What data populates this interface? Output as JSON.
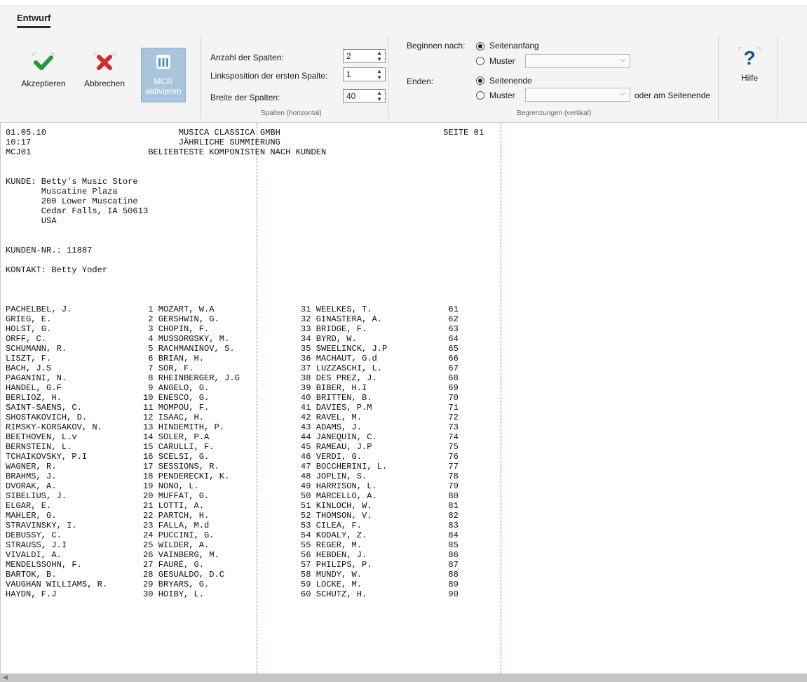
{
  "ribbon": {
    "tab": "Entwurf",
    "buttons": {
      "accept": "Akzeptieren",
      "cancel": "Abbrechen",
      "mcr_line1": "MCR",
      "mcr_line2": "aktivieren",
      "help": "Hilfe"
    },
    "columns_group": {
      "count_label": "Anzahl der Spalten:",
      "count_value": "2",
      "left_label": "Linksposition der ersten Spalte:",
      "left_value": "1",
      "width_label": "Breite der Spalten:",
      "width_value": "40",
      "caption": "Spalten (horizontal)"
    },
    "limits_group": {
      "begin_label": "Beginnen nach:",
      "begin_opt1": "Seitenanfang",
      "begin_opt2": "Muster",
      "end_label": "Enden:",
      "end_opt1": "Seitenende",
      "end_opt2": "Muster",
      "end_suffix": "oder am Seitenende",
      "caption": "Begrenzungen (vertikal)"
    }
  },
  "report": {
    "lines": [
      "01.05.10                          MUSICA CLASSICA GMBH                                SEITE 01",
      "10:17                             JÄHRLICHE SUMMIERUNG",
      "MCJ01                       BELIEBTESTE KOMPONISTEN NACH KUNDEN",
      "",
      "",
      "KUNDE: Betty's Music Store",
      "       Muscatine Plaza",
      "       200 Lower Muscatine",
      "       Cedar Falls, IA 50613",
      "       USA",
      "",
      "",
      "KUNDEN-NR.: 11887",
      "",
      "KONTAKT: Betty Yoder",
      "",
      "",
      "",
      "PACHELBEL, J.               1 MOZART, W.A                 31 WEELKES, T.               61",
      "GRIEG, E.                   2 GERSHWIN, G.                32 GINASTERA, A.             62",
      "HOLST, G.                   3 CHOPIN, F.                  33 BRIDGE, F.                63",
      "ORFF, C.                    4 MUSSORGSKY, M.              34 BYRD, W.                  64",
      "SCHUMANN, R.                5 RACHMANINOV, S.             35 SWEELINCK, J.P            65",
      "LISZT, F.                   6 BRIAN, H.                   36 MACHAUT, G.d              66",
      "BACH, J.S                   7 SOR, F.                     37 LUZZASCHI, L.             67",
      "PAGANINI, N.                8 RHEINBERGER, J.G            38 DES PREZ, J.              68",
      "HANDEL, G.F                 9 ANGELO, G.                  39 BIBER, H.I                69",
      "BERLIOZ, H.                10 ENESCO, G.                  40 BRITTEN, B.               70",
      "SAINT-SAENS, C.            11 MOMPOU, F.                  41 DAVIES, P.M               71",
      "SHOSTAKOVICH, D.           12 ISAAC, H.                   42 RAVEL, M.                 72",
      "RIMSKY-KORSAKOV, N.        13 HINDEMITH, P.               43 ADAMS, J.                 73",
      "BEETHOVEN, L.v             14 SOLER, P.A                  44 JANEQUIN, C.              74",
      "BERNSTEIN, L.              15 CARULLI, F.                 45 RAMEAU, J.P               75",
      "TCHAIKOVSKY, P.I           16 SCELSI, G.                  46 VERDI, G.                 76",
      "WAGNER, R.                 17 SESSIONS, R.                47 BOCCHERINI, L.            77",
      "BRAHMS, J.                 18 PENDERECKI, K.              48 JOPLIN, S.                78",
      "DVORAK, A.                 19 NONO, L.                    49 HARRISON, L.              79",
      "SIBELIUS, J.               20 MUFFAT, G.                  50 MARCELLO, A.              80",
      "ELGAR, E.                  21 LOTTI, A.                   51 KINLOCH, W.               81",
      "MAHLER, G.                 22 PARTCH, H.                  52 THOMSON, V.               82",
      "STRAVINSKY, I.             23 FALLA, M.d                  53 CILEA, F.                 83",
      "DEBUSSY, C.                24 PUCCINI, G.                 54 KODALY, Z.                84",
      "STRAUSS, J.I               25 WILDER, A.                  55 REGER, M.                 85",
      "VIVALDI, A.                26 VAINBERG, M.                56 HEBDEN, J.                86",
      "MENDELSSOHN, F.            27 FAURÉ, G.                   57 PHILIPS, P.               87",
      "BARTOK, B.                 28 GESUALDO, D.C               58 MUNDY, W.                 88",
      "VAUGHAN WILLIAMS, R.       29 BRYARS, G.                  59 LOCKE, M.                 89",
      "HAYDN, F.J                 30 HOIBY, L.                   60 SCHUTZ, H.                90"
    ]
  },
  "icons": {
    "accept": "checkmark-icon",
    "cancel": "x-icon",
    "mcr": "columns-icon",
    "help": "question-mark-icon"
  },
  "colors": {
    "accept": "#1f9a3e",
    "cancel": "#d42a2a",
    "help": "#1c4f8f",
    "column_guide": "#e07b3a",
    "mcr_active": "#a9c5dd"
  }
}
